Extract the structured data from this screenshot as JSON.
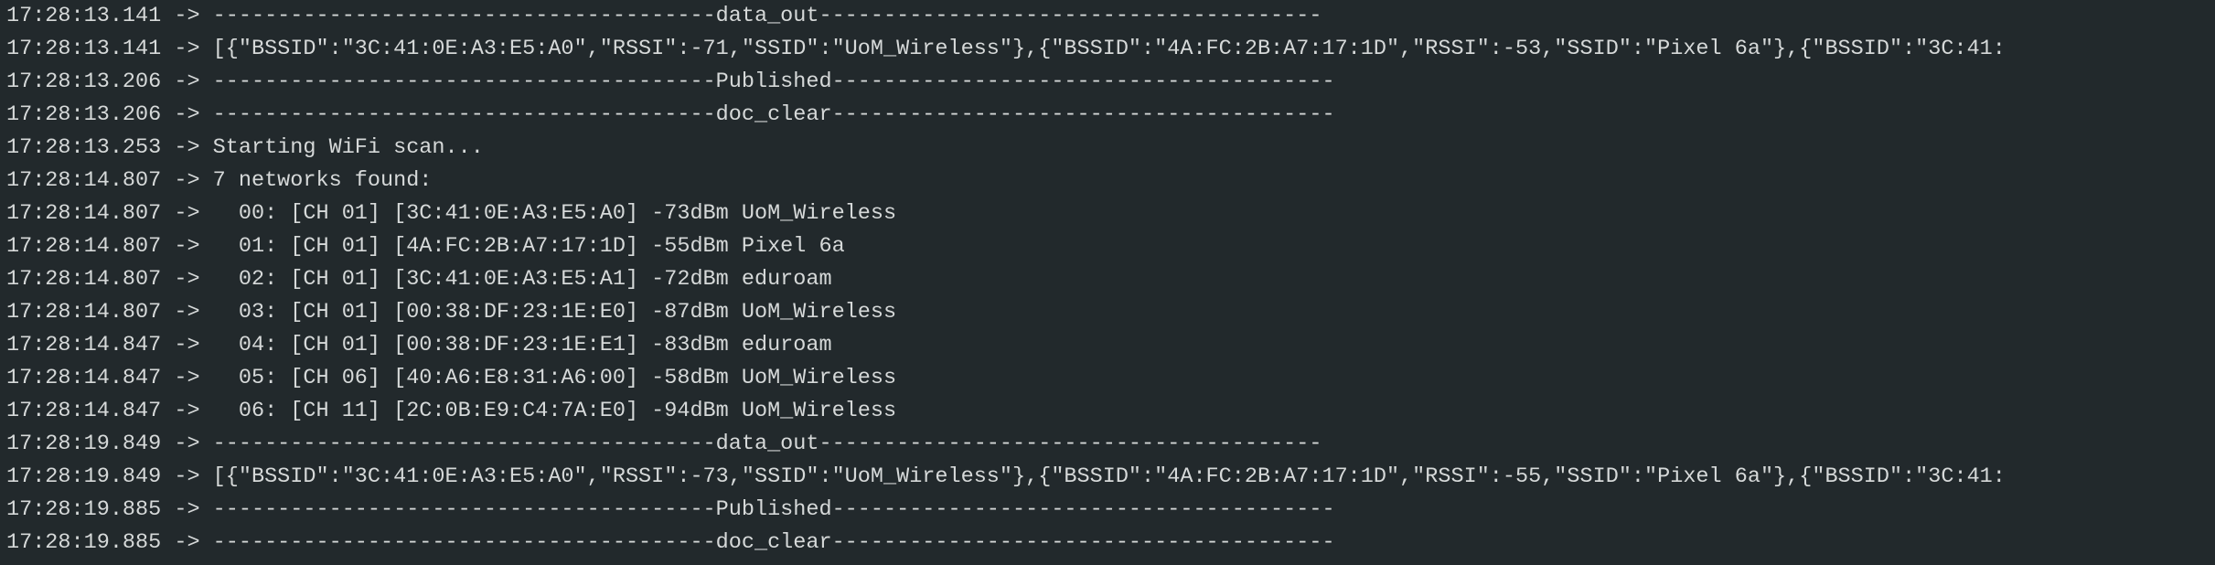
{
  "console": {
    "separator": "->",
    "lines": [
      {
        "timestamp": "17:28:13.141",
        "message": "---------------------------------------data_out---------------------------------------"
      },
      {
        "timestamp": "17:28:13.141",
        "message": "[{\"BSSID\":\"3C:41:0E:A3:E5:A0\",\"RSSI\":-71,\"SSID\":\"UoM_Wireless\"},{\"BSSID\":\"4A:FC:2B:A7:17:1D\",\"RSSI\":-53,\"SSID\":\"Pixel 6a\"},{\"BSSID\":\"3C:41:"
      },
      {
        "timestamp": "17:28:13.206",
        "message": "---------------------------------------Published---------------------------------------"
      },
      {
        "timestamp": "17:28:13.206",
        "message": "---------------------------------------doc_clear---------------------------------------"
      },
      {
        "timestamp": "17:28:13.253",
        "message": "Starting WiFi scan..."
      },
      {
        "timestamp": "17:28:14.807",
        "message": "7 networks found:"
      },
      {
        "timestamp": "17:28:14.807",
        "message": "  00: [CH 01] [3C:41:0E:A3:E5:A0] -73dBm UoM_Wireless"
      },
      {
        "timestamp": "17:28:14.807",
        "message": "  01: [CH 01] [4A:FC:2B:A7:17:1D] -55dBm Pixel 6a"
      },
      {
        "timestamp": "17:28:14.807",
        "message": "  02: [CH 01] [3C:41:0E:A3:E5:A1] -72dBm eduroam"
      },
      {
        "timestamp": "17:28:14.807",
        "message": "  03: [CH 01] [00:38:DF:23:1E:E0] -87dBm UoM_Wireless"
      },
      {
        "timestamp": "17:28:14.847",
        "message": "  04: [CH 01] [00:38:DF:23:1E:E1] -83dBm eduroam"
      },
      {
        "timestamp": "17:28:14.847",
        "message": "  05: [CH 06] [40:A6:E8:31:A6:00] -58dBm UoM_Wireless"
      },
      {
        "timestamp": "17:28:14.847",
        "message": "  06: [CH 11] [2C:0B:E9:C4:7A:E0] -94dBm UoM_Wireless"
      },
      {
        "timestamp": "17:28:19.849",
        "message": "---------------------------------------data_out---------------------------------------"
      },
      {
        "timestamp": "17:28:19.849",
        "message": "[{\"BSSID\":\"3C:41:0E:A3:E5:A0\",\"RSSI\":-73,\"SSID\":\"UoM_Wireless\"},{\"BSSID\":\"4A:FC:2B:A7:17:1D\",\"RSSI\":-55,\"SSID\":\"Pixel 6a\"},{\"BSSID\":\"3C:41:"
      },
      {
        "timestamp": "17:28:19.885",
        "message": "---------------------------------------Published---------------------------------------"
      },
      {
        "timestamp": "17:28:19.885",
        "message": "---------------------------------------doc_clear---------------------------------------"
      }
    ]
  }
}
